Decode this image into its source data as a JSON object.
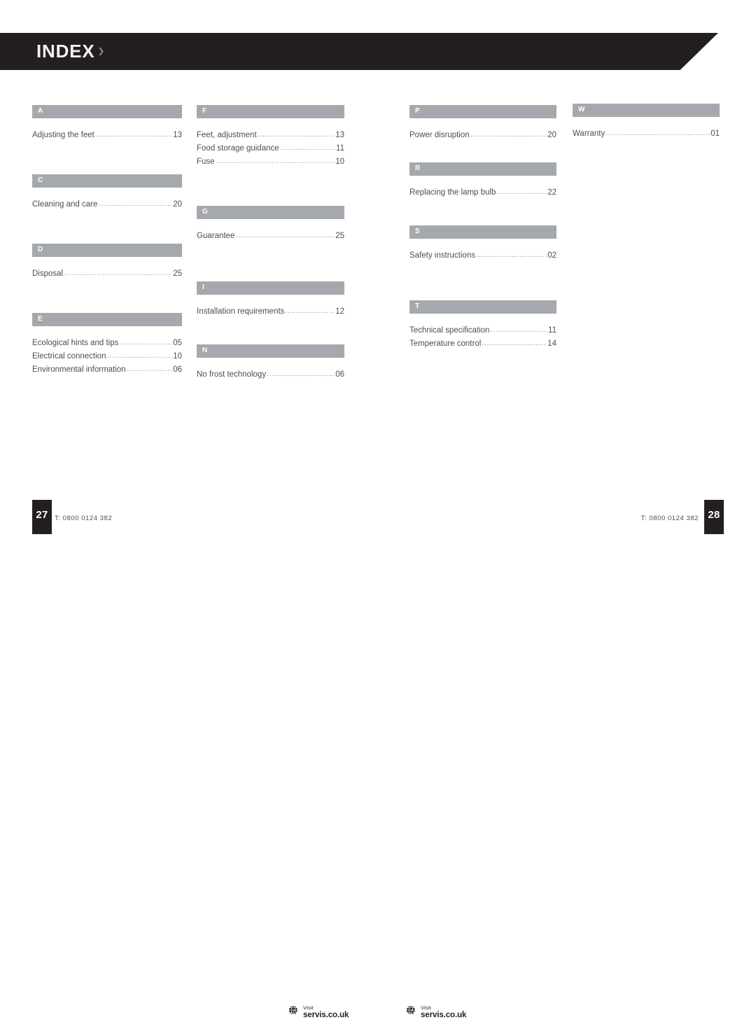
{
  "header": {
    "title": "INDEX",
    "chevron": "›",
    "band_color": "#231f20"
  },
  "index": {
    "bar_color": "#a5a9ad",
    "columns": [
      {
        "id": "column-1",
        "sections": [
          {
            "letter": "A",
            "entries": [
              {
                "title": "Adjusting the feet",
                "page": "13"
              }
            ]
          },
          {
            "letter": "C",
            "entries": [
              {
                "title": "Cleaning and care",
                "page": "20"
              }
            ]
          },
          {
            "letter": "D",
            "entries": [
              {
                "title": "Disposal",
                "page": "25"
              }
            ]
          },
          {
            "letter": "E",
            "entries": [
              {
                "title": "Ecological hints and tips",
                "page": "05"
              },
              {
                "title": "Electrical connection",
                "page": "10"
              },
              {
                "title": "Environmental information",
                "page": "06"
              }
            ]
          }
        ]
      },
      {
        "id": "column-2",
        "sections": [
          {
            "letter": "F",
            "entries": [
              {
                "title": "Feet, adjustment",
                "page": "13"
              },
              {
                "title": "Food storage guidance",
                "page": "11"
              },
              {
                "title": "Fuse",
                "page": "10"
              }
            ]
          },
          {
            "letter": "G",
            "entries": [
              {
                "title": "Guarantee",
                "page": "25"
              }
            ]
          },
          {
            "letter": "I",
            "entries": [
              {
                "title": "Installation requirements",
                "page": "12"
              }
            ]
          },
          {
            "letter": "N",
            "entries": [
              {
                "title": "No frost technology",
                "page": "06"
              }
            ]
          }
        ]
      },
      {
        "id": "column-3",
        "sections": [
          {
            "letter": "P",
            "entries": [
              {
                "title": "Power disruption",
                "page": "20"
              }
            ]
          },
          {
            "letter": "R",
            "entries": [
              {
                "title": "Replacing the lamp bulb",
                "page": "22"
              }
            ]
          },
          {
            "letter": "S",
            "entries": [
              {
                "title": "Safety instructions",
                "page": "02"
              }
            ]
          },
          {
            "letter": "T",
            "entries": [
              {
                "title": "Technical specification",
                "page": "11"
              },
              {
                "title": "Temperature control",
                "page": "14"
              }
            ]
          }
        ]
      },
      {
        "id": "column-4",
        "sections": [
          {
            "letter": "W",
            "entries": [
              {
                "title": "Warranty",
                "page": "01"
              }
            ]
          }
        ]
      }
    ]
  },
  "footer": {
    "left_page_number": "27",
    "right_page_number": "28",
    "left_phone": "T: 0800 0124 382",
    "right_phone": "T: 0800 0124 382",
    "visit_left": {
      "label": "Visit",
      "url": "servis.co.uk",
      "icon": "globe-cursor-icon"
    },
    "visit_right": {
      "label": "Visit",
      "url": "servis.co.uk",
      "icon": "globe-cursor-icon"
    }
  }
}
